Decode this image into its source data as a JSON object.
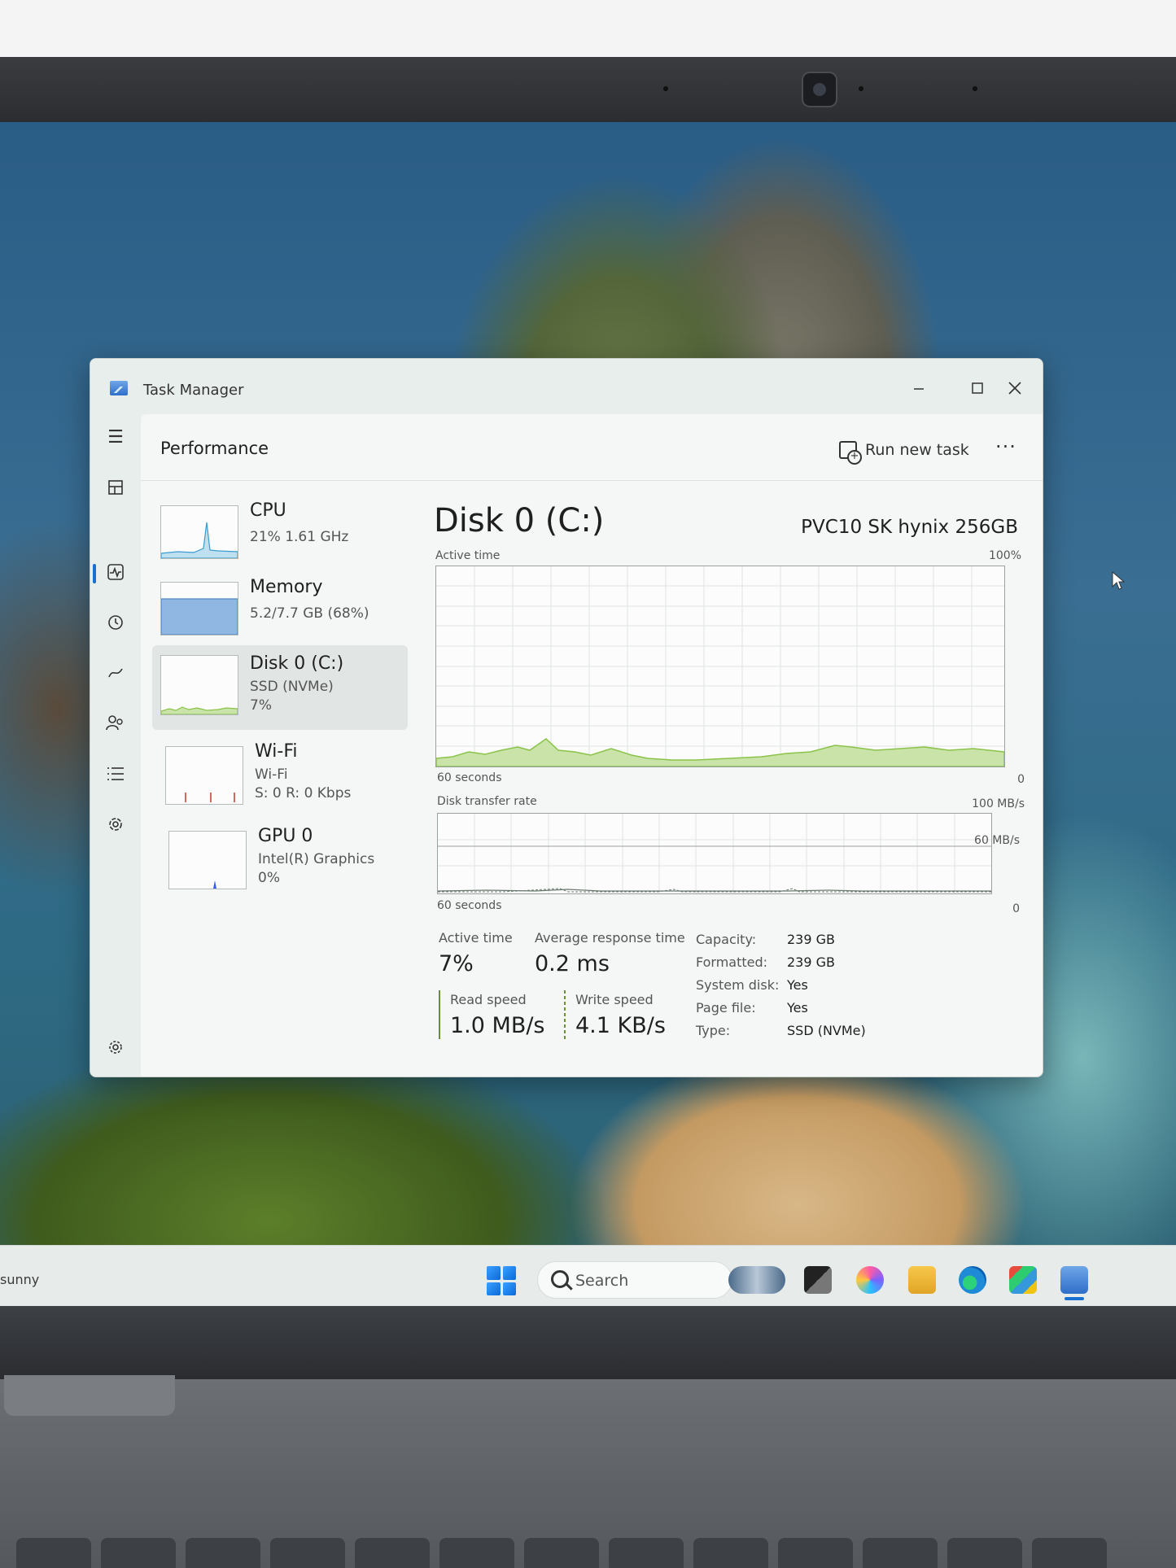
{
  "window": {
    "title": "Task Manager"
  },
  "header": {
    "title": "Performance",
    "run_new_task": "Run new task"
  },
  "devices": [
    {
      "name": "CPU",
      "line1": "21% 1.61 GHz",
      "line2": ""
    },
    {
      "name": "Memory",
      "line1": "5.2/7.7 GB (68%)",
      "line2": ""
    },
    {
      "name": "Disk 0 (C:)",
      "line1": "SSD (NVMe)",
      "line2": "7%"
    },
    {
      "name": "Wi-Fi",
      "line1": "Wi-Fi",
      "line2": "S: 0 R: 0 Kbps"
    },
    {
      "name": "GPU 0",
      "line1": "Intel(R) Graphics",
      "line2": "0%"
    }
  ],
  "disk": {
    "title": "Disk 0 (C:)",
    "model": "PVC10 SK hynix 256GB",
    "active_time_graph": {
      "label": "Active time",
      "max": "100%",
      "time_label": "60 seconds",
      "min": "0"
    },
    "transfer_graph": {
      "label": "Disk transfer rate",
      "max": "100 MB/s",
      "mid": "60 MB/s",
      "time_label": "60 seconds",
      "min": "0"
    },
    "stats": {
      "active_time_label": "Active time",
      "active_time_value": "7%",
      "avg_response_label": "Average response time",
      "avg_response_value": "0.2 ms",
      "read_label": "Read speed",
      "read_value": "1.0 MB/s",
      "write_label": "Write speed",
      "write_value": "4.1 KB/s"
    },
    "properties": [
      {
        "label": "Capacity:",
        "value": "239 GB"
      },
      {
        "label": "Formatted:",
        "value": "239 GB"
      },
      {
        "label": "System disk:",
        "value": "Yes"
      },
      {
        "label": "Page file:",
        "value": "Yes"
      },
      {
        "label": "Type:",
        "value": "SSD (NVMe)"
      }
    ]
  },
  "taskbar": {
    "weather": "sunny",
    "search_label": "Search"
  },
  "colors": {
    "disk_green": "#8bc34a",
    "disk_green_fill": "#c9e3a8",
    "accent": "#1b6fd1",
    "memory_blue": "#6fa3d8",
    "wifi_red": "#c0392b",
    "gpu_blue": "#3d5afe"
  }
}
